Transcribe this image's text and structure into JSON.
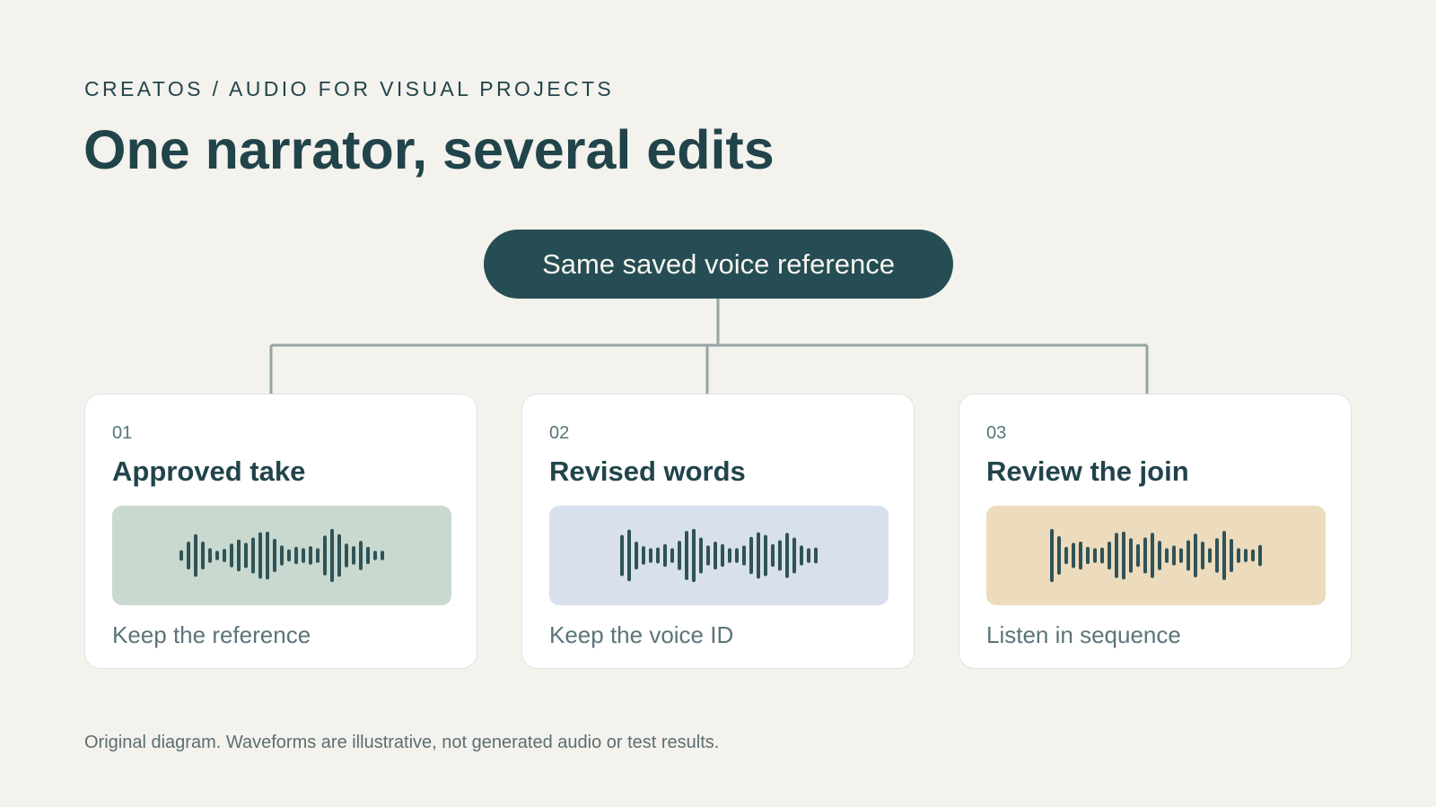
{
  "header": {
    "eyebrow": "CREATOS / AUDIO FOR VISUAL PROJECTS",
    "title": "One narrator, several edits"
  },
  "diagram": {
    "hub_label": "Same saved voice reference",
    "cards": [
      {
        "number": "01",
        "title": "Approved take",
        "caption": "Keep the reference",
        "panel_color": "#c9d9d0",
        "bar_levels": [
          0.16,
          0.42,
          0.64,
          0.42,
          0.22,
          0.14,
          0.2,
          0.36,
          0.48,
          0.38,
          0.54,
          0.7,
          0.72,
          0.5,
          0.3,
          0.18,
          0.26,
          0.22,
          0.28,
          0.22,
          0.6,
          0.8,
          0.64,
          0.36,
          0.28,
          0.44,
          0.26,
          0.14,
          0.14
        ]
      },
      {
        "number": "02",
        "title": "Revised words",
        "caption": "Keep the voice ID",
        "panel_color": "#d8e0ee",
        "bar_levels": [
          0.62,
          0.78,
          0.42,
          0.28,
          0.22,
          0.24,
          0.34,
          0.22,
          0.44,
          0.74,
          0.8,
          0.54,
          0.3,
          0.42,
          0.34,
          0.22,
          0.22,
          0.3,
          0.56,
          0.7,
          0.62,
          0.34,
          0.46,
          0.68,
          0.54,
          0.3,
          0.22,
          0.24
        ]
      },
      {
        "number": "03",
        "title": "Review the join",
        "caption": "Listen in sequence",
        "panel_color": "#ecdbbd",
        "bar_levels": [
          0.8,
          0.58,
          0.26,
          0.38,
          0.42,
          0.26,
          0.22,
          0.24,
          0.42,
          0.68,
          0.72,
          0.52,
          0.34,
          0.54,
          0.68,
          0.44,
          0.22,
          0.3,
          0.22,
          0.46,
          0.66,
          0.42,
          0.22,
          0.52,
          0.74,
          0.5,
          0.22,
          0.2,
          0.18,
          0.32
        ]
      }
    ]
  },
  "footer": {
    "note": "Original diagram. Waveforms are illustrative, not generated audio or test results."
  }
}
